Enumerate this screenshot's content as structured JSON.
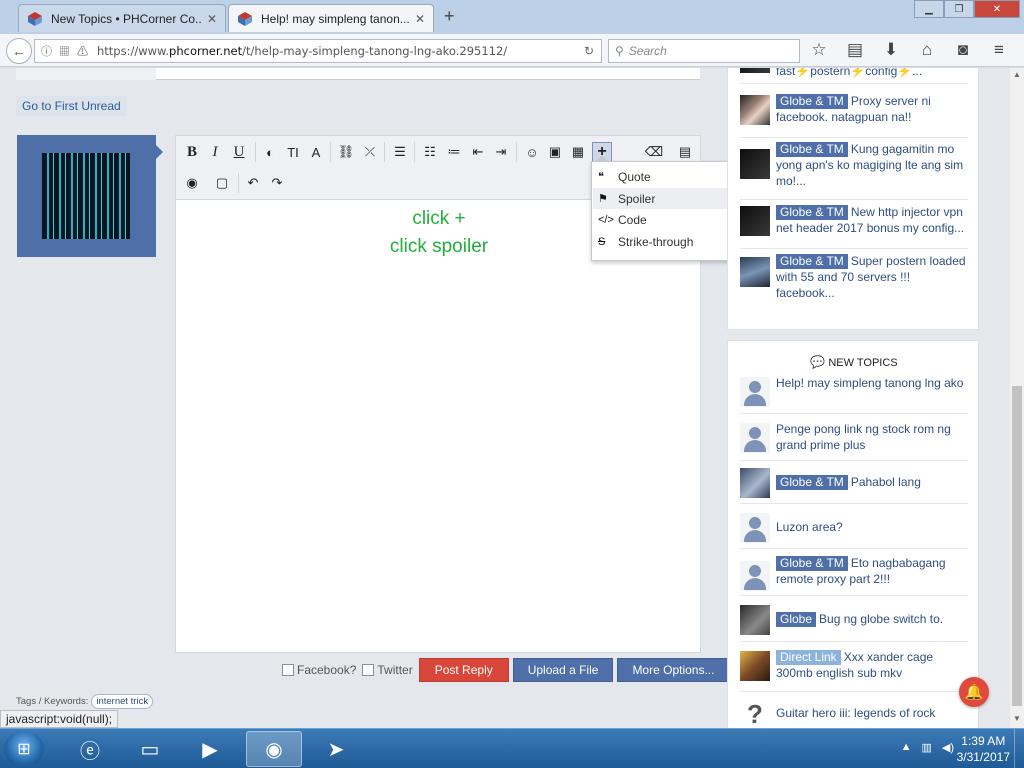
{
  "browser": {
    "tabs": [
      {
        "title": "New Topics • PHCorner Co...",
        "active": false
      },
      {
        "title": "Help! may simpleng tanon...",
        "active": true
      }
    ],
    "url_prefix": "https://www.",
    "url_domain": "phcorner.net",
    "url_path": "/t/help-may-simpleng-tanong-lng-ako.295112/",
    "search_placeholder": "Search"
  },
  "page": {
    "goto_first_unread": "Go to First Unread",
    "hint_line1": "click +",
    "hint_line2": "click spoiler",
    "insert_menu": [
      "Quote",
      "Spoiler",
      "Code",
      "Strike-through"
    ],
    "share_facebook": "Facebook?",
    "share_twitter": "Twitter",
    "post_reply": "Post Reply",
    "upload_file": "Upload a File",
    "more_options": "More Options...",
    "tags_label": "Tags / Keywords:",
    "tag": "internet trick",
    "status_link": "javascript:void(null);"
  },
  "sidebar": {
    "top_items": [
      {
        "badge": "",
        "text": "fast⚡postern⚡config⚡..."
      },
      {
        "badge": "Globe & TM",
        "text": "Proxy server ni facebook. natagpuan na!!"
      },
      {
        "badge": "Globe & TM",
        "text": "Kung gagamitin mo yong apn's ko magiging lte ang sim mo!..."
      },
      {
        "badge": "Globe & TM",
        "text": "New http injector vpn net header 2017 bonus my config..."
      },
      {
        "badge": "Globe & TM",
        "text": "Super postern loaded with 55 and 70 servers !!! facebook..."
      }
    ],
    "new_topics_heading": "NEW TOPICS",
    "new_topics": [
      {
        "badge": "",
        "text": "Help! may simpleng tanong lng ako"
      },
      {
        "badge": "",
        "text": "Penge pong link ng stock rom ng grand prime plus"
      },
      {
        "badge": "Globe & TM",
        "text": "Pahabol lang"
      },
      {
        "badge": "",
        "text": "Luzon area?"
      },
      {
        "badge": "Globe & TM",
        "text": "Eto nagbabagang remote proxy part 2!!!"
      },
      {
        "badge": "Globe",
        "text": "Bug ng globe switch to."
      },
      {
        "badge": "Direct Link",
        "text": "Xxx xander cage 300mb english sub mkv"
      },
      {
        "badge": "",
        "text": "Guitar hero iii: legends of rock"
      }
    ]
  },
  "taskbar": {
    "time": "1:39 AM",
    "date": "3/31/2017"
  }
}
